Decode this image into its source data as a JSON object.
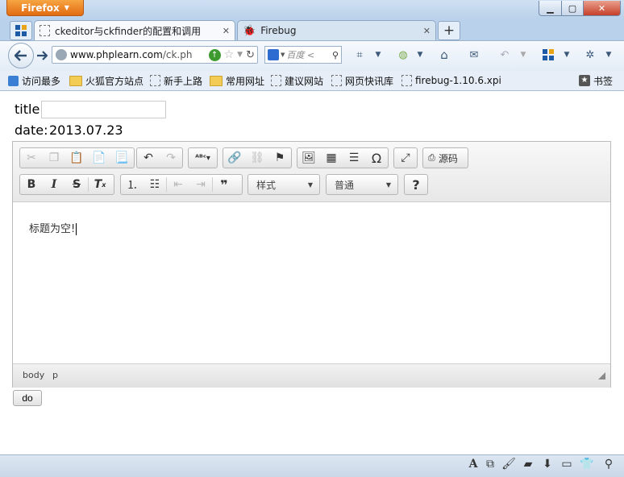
{
  "browser": {
    "app_button": "Firefox",
    "window_controls": {
      "minimize": "▁",
      "maximize": "▢",
      "close": "✕"
    },
    "tabs": [
      {
        "label": "ckeditor与ckfinder的配置和调用",
        "close": "✕"
      },
      {
        "label": "Firebug",
        "close": "✕"
      }
    ],
    "new_tab": "+",
    "url": {
      "host": "www.phplearn.com",
      "path": "/ck.ph"
    },
    "search": {
      "placeholder": "百度 <"
    },
    "bookmarks": [
      {
        "label": "访问最多",
        "icon": "blue-square-icon"
      },
      {
        "label": "火狐官方站点",
        "icon": "folder-icon"
      },
      {
        "label": "新手上路",
        "icon": "blank-page-icon"
      },
      {
        "label": "常用网址",
        "icon": "folder-icon"
      },
      {
        "label": "建议网站",
        "icon": "blank-page-icon"
      },
      {
        "label": "网页快讯库",
        "icon": "blank-page-icon"
      },
      {
        "label": "firebug-1.10.6.xpi",
        "icon": "blank-page-icon"
      }
    ],
    "bookmarks_menu": "书签"
  },
  "page": {
    "title_label": "title:",
    "date_label": "date:",
    "date_value": "2013.07.23",
    "editor": {
      "source_label": "源码",
      "styles_combo": "样式",
      "format_combo": "普通",
      "content": "标题为空!",
      "path": [
        "body",
        "p"
      ]
    },
    "do_button": "do"
  },
  "colors": {
    "firefox_orange": "#e8791c",
    "chrome_blue": "#b9d1ea"
  }
}
